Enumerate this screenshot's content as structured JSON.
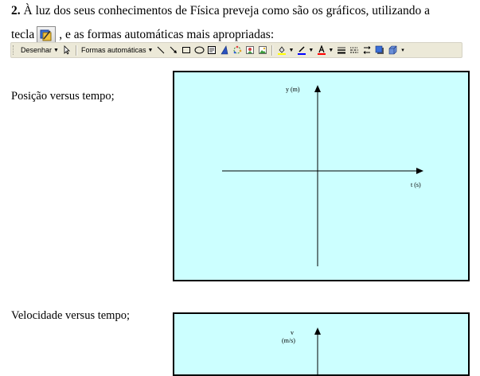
{
  "question": {
    "number": "2.",
    "line1_text": " À luz dos seus conhecimentos de Física preveja como são os gráficos, utilizando a",
    "line2_before": "tecla",
    "line2_after": ", e as formas automáticas mais apropriadas:"
  },
  "toolbar": {
    "draw_label": "Desenhar",
    "autoshapes_label": "Formas automáticas",
    "icons": [
      "select-pointer-icon",
      "line-icon",
      "arrow-icon",
      "rectangle-icon",
      "oval-icon",
      "textbox-icon",
      "wordart-icon",
      "diagram-icon",
      "clipart-icon",
      "picture-icon",
      "fill-color-icon",
      "line-color-icon",
      "font-color-icon",
      "line-style-icon",
      "dash-style-icon",
      "arrow-style-icon",
      "shadow-icon",
      "3d-icon"
    ],
    "colors": {
      "fill": "#ffff00",
      "line": "#0000ff",
      "font": "#ff0000"
    }
  },
  "graphs": [
    {
      "label": "Posição versus tempo;",
      "y_axis": "y (m)",
      "x_axis": "t (s)"
    },
    {
      "label": "Velocidade versus tempo;",
      "y_axis_line1": "v",
      "y_axis_line2": "(m/s)"
    }
  ],
  "colors": {
    "graph_bg": "#ccffff",
    "toolbar_bg": "#ece9d8"
  }
}
